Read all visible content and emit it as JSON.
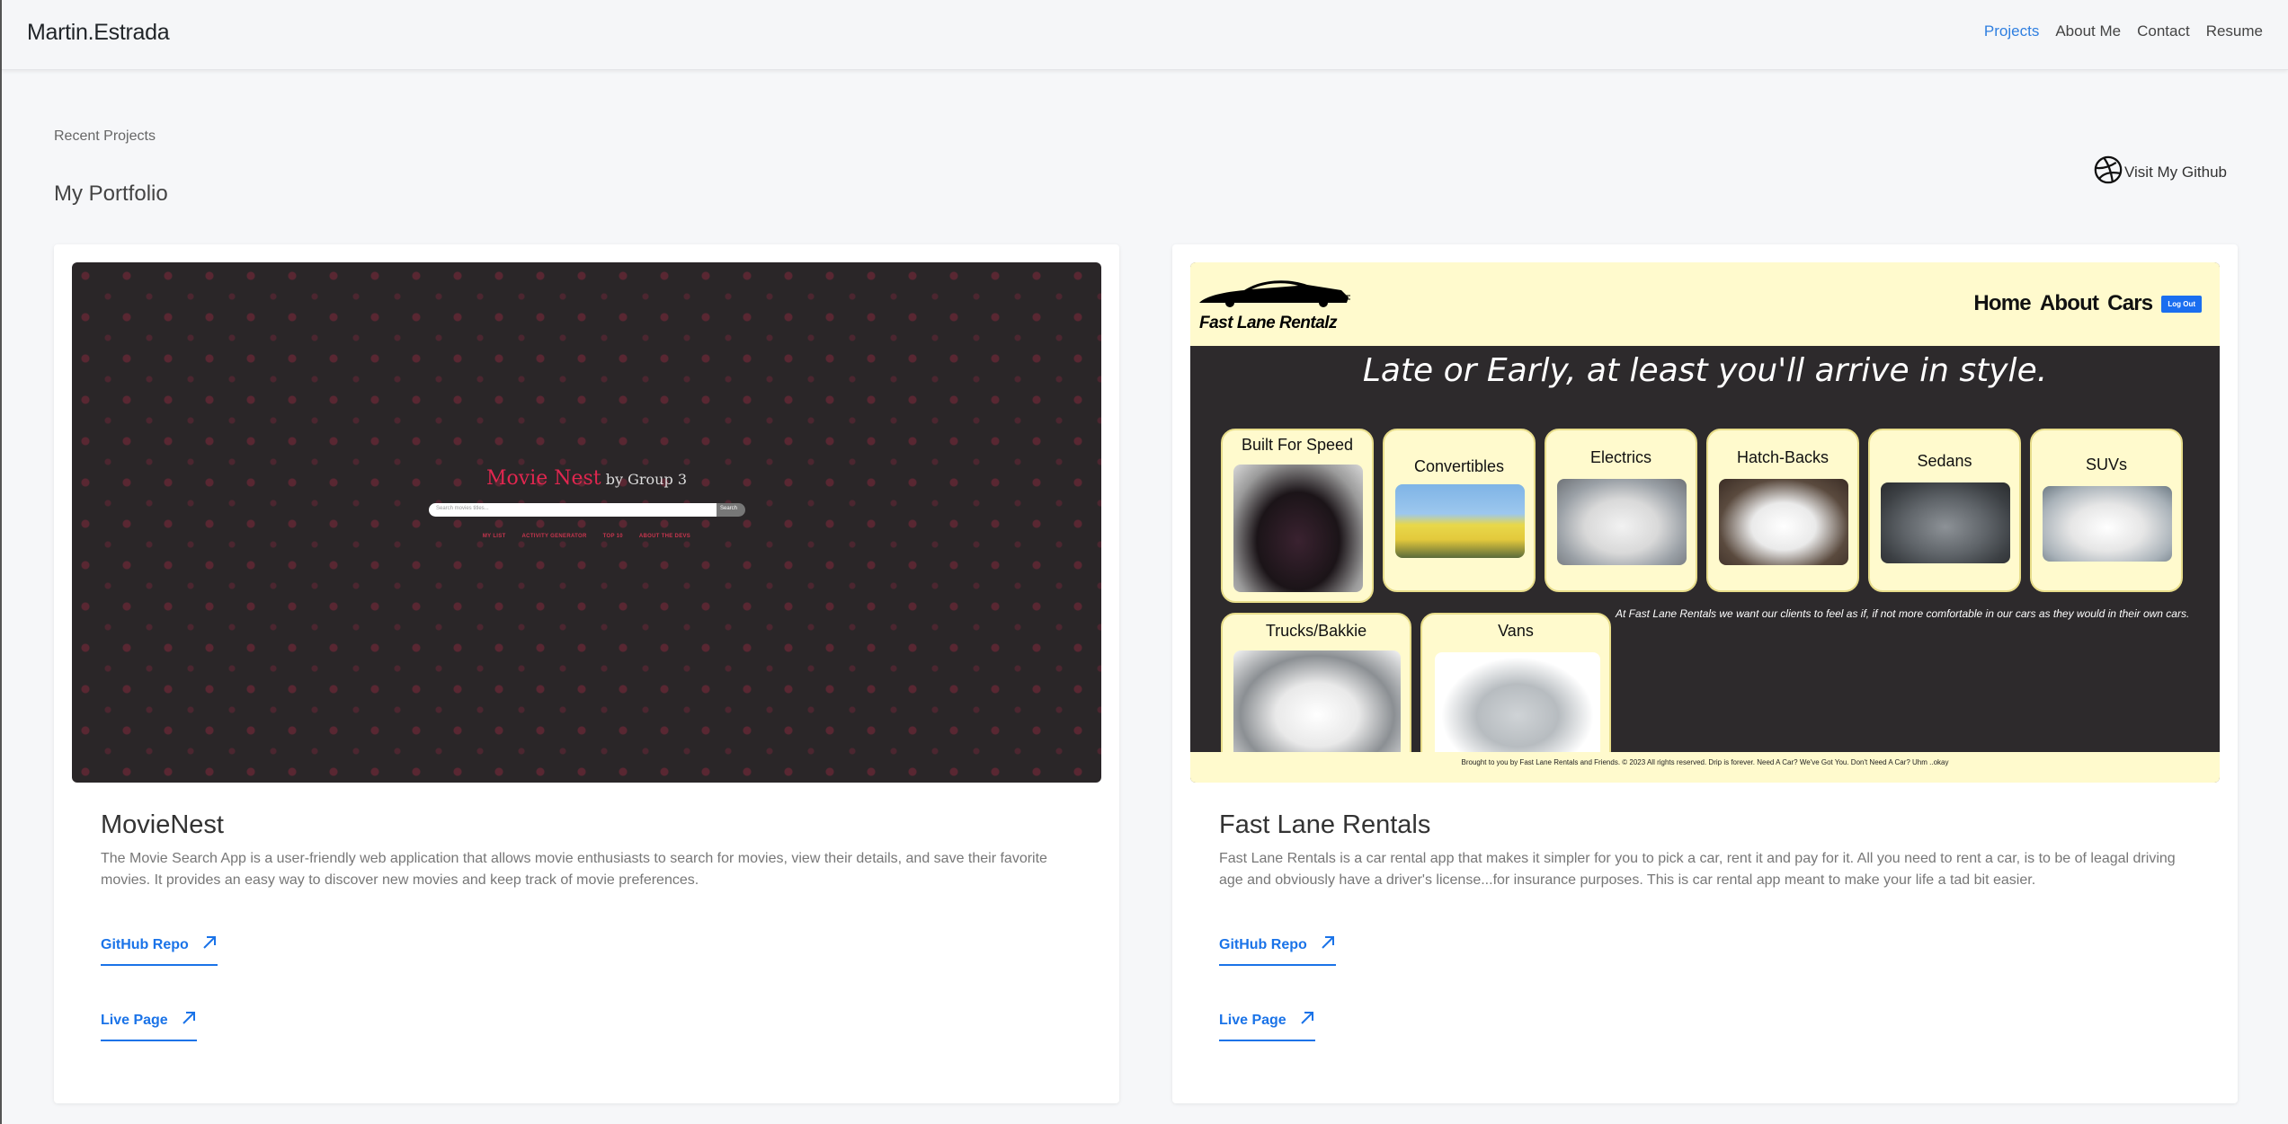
{
  "header": {
    "brand": "Martin.Estrada",
    "nav": [
      {
        "label": "Projects",
        "active": true
      },
      {
        "label": "About Me",
        "active": false
      },
      {
        "label": "Contact",
        "active": false
      },
      {
        "label": "Resume",
        "active": false
      }
    ]
  },
  "section": {
    "eyebrow": "Recent Projects",
    "title": "My Portfolio",
    "github_link": "Visit My Github"
  },
  "projects": [
    {
      "title": "MovieNest",
      "description": "The Movie Search App is a user-friendly web application that allows movie enthusiasts to search for movies, view their details, and save their favorite movies. It provides an easy way to discover new movies and keep track of movie preferences.",
      "repo_label": "GitHub Repo",
      "live_label": "Live Page",
      "screenshot": {
        "app_name": "Movie Nest",
        "by_line": "by Group 3",
        "search_placeholder": "Search movies titles...",
        "search_button": "Search",
        "menu": [
          "MY LIST",
          "ACTIVITY GENERATOR",
          "TOP 10",
          "ABOUT THE DEVS"
        ]
      }
    },
    {
      "title": "Fast Lane Rentals",
      "description": "Fast Lane Rentals is a car rental app that makes it simpler for you to pick a car, rent it and pay for it. All you need to rent a car, is to be of leagal driving age and obviously have a driver's license...for insurance purposes. This is car rental app meant to make your life a tad bit easier.",
      "repo_label": "GitHub Repo",
      "live_label": "Live Page",
      "screenshot": {
        "logo": "Fast Lane Rentalz",
        "nav": [
          "Home",
          "About",
          "Cars"
        ],
        "logout": "Log Out",
        "tagline": "Late or Early, at least you'll arrive in style.",
        "categories": [
          "Built For Speed",
          "Convertibles",
          "Electrics",
          "Hatch-Backs",
          "Sedans",
          "SUVs",
          "Trucks/Bakkie",
          "Vans"
        ],
        "about": "At Fast Lane Rentals we want our clients to feel as if, if not more comfortable in our cars as they would in their own cars.",
        "footer": "Brought to you by Fast Lane Rentals and Friends. © 2023 All rights reserved. Drip is forever. Need A Car? We've Got You. Don't Need A Car? Uhm ..okay"
      }
    }
  ],
  "colors": {
    "accent": "#1a73e8",
    "nav_active": "#2f7fe0",
    "movie_red": "#e0264f",
    "fastlane_yellow": "#fffacd"
  }
}
